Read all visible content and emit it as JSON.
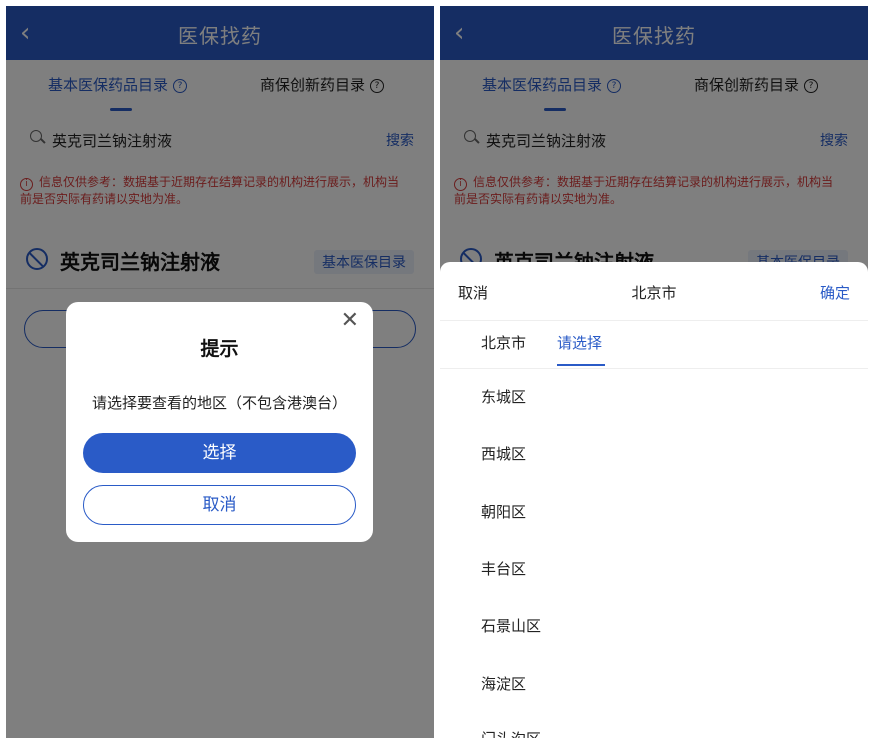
{
  "header": {
    "title": "医保找药",
    "back_icon": "‹"
  },
  "tabs": [
    {
      "label": "基本医保药品目录"
    },
    {
      "label": "商保创新药目录"
    }
  ],
  "search": {
    "value": "英克司兰钠注射液",
    "button": "搜索"
  },
  "notice": {
    "text": "信息仅供参考：数据基于近期存在结算记录的机构进行展示，机构当前是否实际有药请以实地为准。"
  },
  "drug": {
    "name": "英克司兰钠注射液",
    "tag": "基本医保目录"
  },
  "dialog": {
    "title": "提示",
    "message": "请选择要查看的地区（不包含港澳台）",
    "confirm": "选择",
    "cancel": "取消"
  },
  "sheet": {
    "cancel": "取消",
    "title": "北京市",
    "ok": "确定",
    "tabs": [
      "北京市",
      "请选择"
    ],
    "districts": [
      "东城区",
      "西城区",
      "朝阳区",
      "丰台区",
      "石景山区",
      "海淀区",
      "门头沟区"
    ]
  },
  "colors": {
    "primary": "#2a5bc7",
    "warning": "#d63b3b"
  }
}
